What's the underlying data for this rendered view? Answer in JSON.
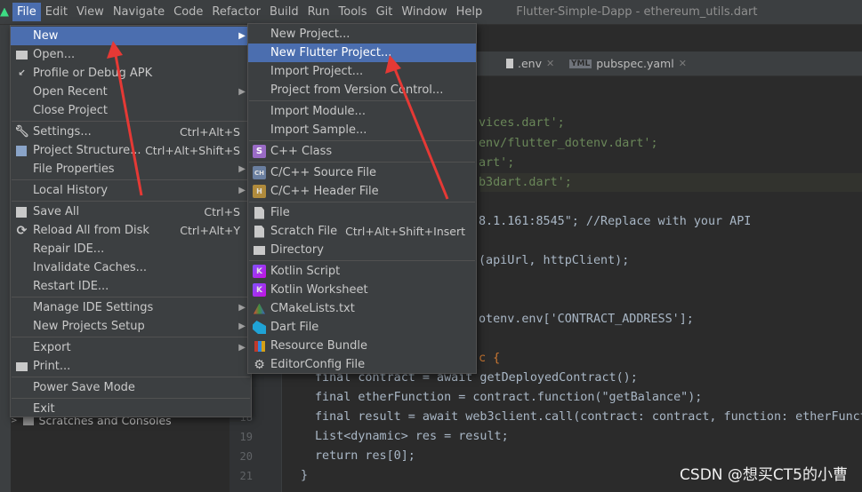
{
  "menubar": {
    "items": [
      "File",
      "Edit",
      "View",
      "Navigate",
      "Code",
      "Refactor",
      "Build",
      "Run",
      "Tools",
      "Git",
      "Window",
      "Help"
    ],
    "window_title": "Flutter-Simple-Dapp - ethereum_utils.dart"
  },
  "tabs": [
    {
      "label": ".env",
      "icon": "file-icon"
    },
    {
      "label": "pubspec.yaml",
      "icon": "yml-icon",
      "icon_text": "YML"
    }
  ],
  "line_numbers": [
    "18",
    "19",
    "20",
    "21"
  ],
  "code": [
    "vices.dart';",
    "env/flutter_dotenv.dart';",
    "art';",
    "b3dart.dart';",
    "8.1.161:8545\"; //Replace with your API",
    "(apiUrl, httpClient);",
    "otenv.env['CONTRACT_ADDRESS'];",
    "c {",
    "final contract = await getDeployedContract();",
    "final etherFunction = contract.function(\"getBalance\");",
    "final result = await web3client.call(contract: contract, function: etherFunct",
    "List<dynamic> res = result;",
    "return res[0];",
    "}"
  ],
  "project_tree": {
    "scratches": "Scratches and Consoles"
  },
  "file_menu": {
    "items": [
      {
        "label": "New",
        "icon": "",
        "submenu": true,
        "selected": true
      },
      {
        "label": "Open...",
        "icon": "folder-icon"
      },
      {
        "label": "Profile or Debug APK",
        "icon": "profile-icon"
      },
      {
        "label": "Open Recent",
        "submenu": true
      },
      {
        "label": "Close Project"
      },
      {
        "label": "Settings...",
        "icon": "wrench-icon",
        "shortcut": "Ctrl+Alt+S"
      },
      {
        "label": "Project Structure...",
        "icon": "structure-icon",
        "shortcut": "Ctrl+Alt+Shift+S"
      },
      {
        "label": "File Properties",
        "submenu": true
      },
      {
        "label": "Local History",
        "submenu": true
      },
      {
        "label": "Save All",
        "icon": "save-icon",
        "shortcut": "Ctrl+S"
      },
      {
        "label": "Reload All from Disk",
        "icon": "reload-icon",
        "shortcut": "Ctrl+Alt+Y"
      },
      {
        "label": "Repair IDE..."
      },
      {
        "label": "Invalidate Caches..."
      },
      {
        "label": "Restart IDE..."
      },
      {
        "label": "Manage IDE Settings",
        "submenu": true
      },
      {
        "label": "New Projects Setup",
        "submenu": true
      },
      {
        "label": "Export",
        "submenu": true
      },
      {
        "label": "Print...",
        "icon": "print-icon"
      },
      {
        "label": "Power Save Mode"
      },
      {
        "label": "Exit"
      }
    ]
  },
  "new_menu": {
    "items": [
      {
        "label": "New Project..."
      },
      {
        "label": "New Flutter Project...",
        "selected": true
      },
      {
        "label": "Import Project..."
      },
      {
        "label": "Project from Version Control..."
      },
      {
        "label": "Import Module..."
      },
      {
        "label": "Import Sample..."
      },
      {
        "label": "C++ Class",
        "icon": "cpp-class-icon",
        "icon_text": "S"
      },
      {
        "label": "C/C++ Source File",
        "icon": "cpp-source-icon",
        "icon_text": "CH"
      },
      {
        "label": "C/C++ Header File",
        "icon": "cpp-header-icon",
        "icon_text": "H"
      },
      {
        "label": "File",
        "icon": "file-icon"
      },
      {
        "label": "Scratch File",
        "icon": "scratch-file-icon",
        "shortcut": "Ctrl+Alt+Shift+Insert"
      },
      {
        "label": "Directory",
        "icon": "folder-icon"
      },
      {
        "label": "Kotlin Script",
        "icon": "kotlin-icon",
        "icon_text": "K"
      },
      {
        "label": "Kotlin Worksheet",
        "icon": "kotlin-icon",
        "icon_text": "K"
      },
      {
        "label": "CMakeLists.txt",
        "icon": "cmake-icon"
      },
      {
        "label": "Dart File",
        "icon": "dart-icon"
      },
      {
        "label": "Resource Bundle",
        "icon": "bundle-icon"
      },
      {
        "label": "EditorConfig File",
        "icon": "gear-icon",
        "icon_text": "⚙"
      }
    ]
  },
  "watermark": "CSDN @想买CT5的小曹",
  "colors": {
    "selection": "#4b6eaf",
    "annotation_arrow": "#e53935"
  }
}
